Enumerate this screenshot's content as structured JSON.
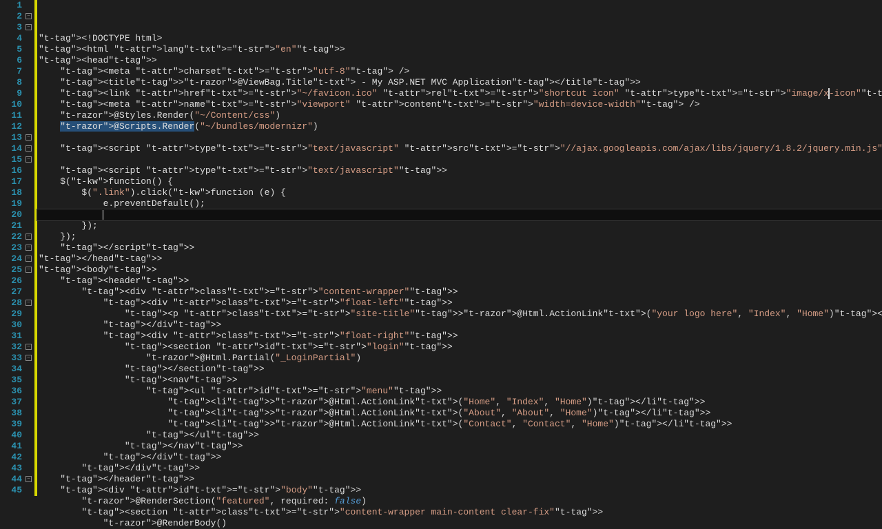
{
  "editor": {
    "visible_line_start": 1,
    "visible_line_end": 45,
    "current_line": 17,
    "text_cursor_right_col": 188,
    "fold_markers_at_lines": [
      2,
      3,
      13,
      14,
      15,
      22,
      23,
      24,
      25,
      28,
      32,
      33,
      44
    ],
    "change_bar_lines_modified": [
      1,
      2,
      3,
      4,
      5,
      6,
      7,
      8,
      9,
      10,
      11,
      12,
      13,
      14,
      15,
      16,
      17,
      18,
      19,
      20,
      21,
      22,
      23,
      24,
      25,
      26,
      27,
      28,
      29,
      30,
      31,
      32,
      33,
      34,
      35,
      36,
      37,
      38,
      39,
      40,
      41,
      42,
      43,
      44,
      45
    ],
    "selection_on_line": 9,
    "lines": {
      "1": {
        "indent": 0,
        "raw": "<!DOCTYPE html>"
      },
      "2": {
        "indent": 0,
        "raw": "<html lang=\"en\">"
      },
      "3": {
        "indent": 0,
        "raw": "<head>"
      },
      "4": {
        "indent": 1,
        "raw": "<meta charset=\"utf-8\" />"
      },
      "5": {
        "indent": 1,
        "raw": "<title>@ViewBag.Title - My ASP.NET MVC Application</title>"
      },
      "6": {
        "indent": 1,
        "raw": "<link href=\"~/favicon.ico\" rel=\"shortcut icon\" type=\"image/x-icon\" />"
      },
      "7": {
        "indent": 1,
        "raw": "<meta name=\"viewport\" content=\"width=device-width\" />"
      },
      "8": {
        "indent": 1,
        "raw": "@Styles.Render(\"~/Content/css\")"
      },
      "9": {
        "indent": 1,
        "raw": "@Scripts.Render(\"~/bundles/modernizr\")"
      },
      "10": {
        "indent": 1,
        "raw": ""
      },
      "11": {
        "indent": 1,
        "raw": "<script type=\"text/javascript\" src=\"//ajax.googleapis.com/ajax/libs/jquery/1.8.2/jquery.min.js\"></script>"
      },
      "12": {
        "indent": 1,
        "raw": ""
      },
      "13": {
        "indent": 1,
        "raw": "<script type=\"text/javascript\">"
      },
      "14": {
        "indent": 1,
        "raw": "$(function() {"
      },
      "15": {
        "indent": 2,
        "raw": "$(\".link\").click(function (e) {"
      },
      "16": {
        "indent": 3,
        "raw": "e.preventDefault();"
      },
      "17": {
        "indent": 3,
        "raw": ""
      },
      "18": {
        "indent": 2,
        "raw": "});"
      },
      "19": {
        "indent": 1,
        "raw": "});"
      },
      "20": {
        "indent": 1,
        "raw": "</script>"
      },
      "21": {
        "indent": 0,
        "raw": "</head>"
      },
      "22": {
        "indent": 0,
        "raw": "<body>"
      },
      "23": {
        "indent": 1,
        "raw": "<header>"
      },
      "24": {
        "indent": 2,
        "raw": "<div class=\"content-wrapper\">"
      },
      "25": {
        "indent": 3,
        "raw": "<div class=\"float-left\">"
      },
      "26": {
        "indent": 4,
        "raw": "<p class=\"site-title\">@Html.ActionLink(\"your logo here\", \"Index\", \"Home\")</p>"
      },
      "27": {
        "indent": 3,
        "raw": "</div>"
      },
      "28": {
        "indent": 3,
        "raw": "<div class=\"float-right\">"
      },
      "29": {
        "indent": 4,
        "raw": "<section id=\"login\">"
      },
      "30": {
        "indent": 5,
        "raw": "@Html.Partial(\"_LoginPartial\")"
      },
      "31": {
        "indent": 4,
        "raw": "</section>"
      },
      "32": {
        "indent": 4,
        "raw": "<nav>"
      },
      "33": {
        "indent": 5,
        "raw": "<ul id=\"menu\">"
      },
      "34": {
        "indent": 6,
        "raw": "<li>@Html.ActionLink(\"Home\", \"Index\", \"Home\")</li>"
      },
      "35": {
        "indent": 6,
        "raw": "<li>@Html.ActionLink(\"About\", \"About\", \"Home\")</li>"
      },
      "36": {
        "indent": 6,
        "raw": "<li>@Html.ActionLink(\"Contact\", \"Contact\", \"Home\")</li>"
      },
      "37": {
        "indent": 5,
        "raw": "</ul>"
      },
      "38": {
        "indent": 4,
        "raw": "</nav>"
      },
      "39": {
        "indent": 3,
        "raw": "</div>"
      },
      "40": {
        "indent": 2,
        "raw": "</div>"
      },
      "41": {
        "indent": 1,
        "raw": "</header>"
      },
      "42": {
        "indent": 1,
        "raw": "<div id=\"body\">"
      },
      "43": {
        "indent": 2,
        "raw": "@RenderSection(\"featured\", required: false)"
      },
      "44": {
        "indent": 2,
        "raw": "<section class=\"content-wrapper main-content clear-fix\">"
      },
      "45": {
        "indent": 3,
        "raw": "@RenderBody()"
      }
    }
  }
}
